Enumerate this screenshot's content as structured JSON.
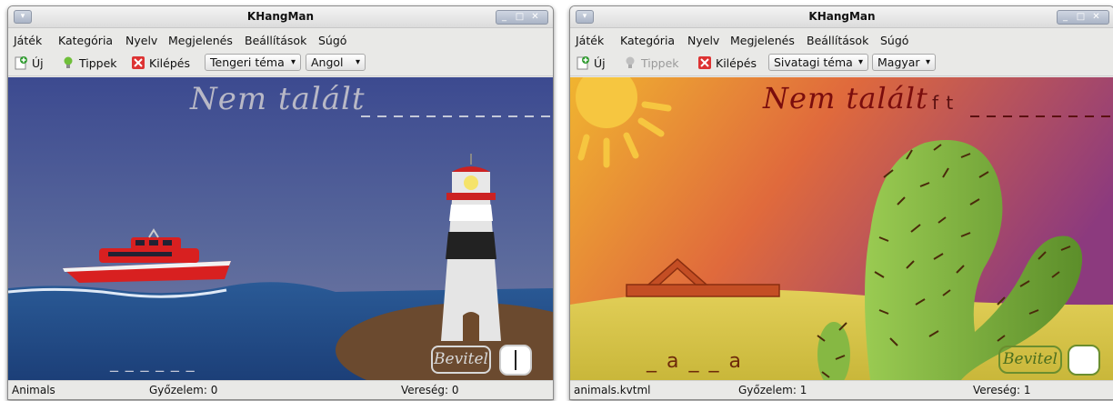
{
  "window_left": {
    "title": "KHangMan",
    "menu": [
      "Játék",
      "Kategória",
      "Nyelv",
      "Megjelenés",
      "Beállítások",
      "Súgó"
    ],
    "toolbar": {
      "new_label": "Új",
      "hint_label": "Tippek",
      "quit_label": "Kilépés",
      "theme_select": "Tengeri téma",
      "language_select": "Angol"
    },
    "game": {
      "heading": "Nem talált",
      "missed_letters": "",
      "word": "_ _ _ _ _ _",
      "input_button": "Bevitel",
      "input_value": ""
    },
    "status": {
      "category": "Animals",
      "wins": "Győzelem: 0",
      "losses": "Vereség: 0"
    }
  },
  "window_right": {
    "title": "KHangMan",
    "menu": [
      "Játék",
      "Kategória",
      "Nyelv",
      "Megjelenés",
      "Beállítások",
      "Súgó"
    ],
    "toolbar": {
      "new_label": "Új",
      "hint_label": "Tippek",
      "quit_label": "Kilépés",
      "theme_select": "Sivatagi téma",
      "language_select": "Magyar"
    },
    "game": {
      "heading": "Nem talált",
      "missed_letters": "f t",
      "word": "_ a _ _ a",
      "input_button": "Bevitel",
      "input_value": ""
    },
    "status": {
      "category": "animals.kvtml",
      "wins": "Győzelem: 1",
      "losses": "Vereség: 1"
    }
  },
  "colors": {
    "sea_sky_top": "#3d4a8e",
    "sea_water": "#2c4f8a",
    "desert_sky": "#c9405a",
    "desert_ground": "#d8c24a",
    "cactus": "#7cae3c",
    "hangman_red": "#7a0d0d"
  }
}
